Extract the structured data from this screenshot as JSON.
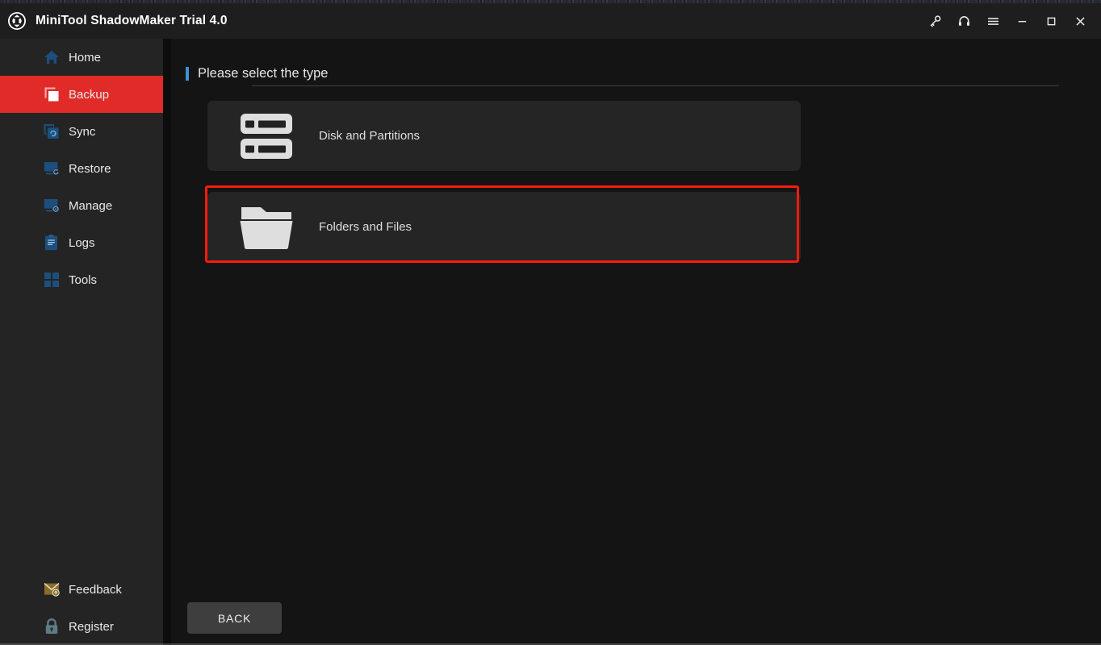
{
  "window": {
    "app_title": "MiniTool ShadowMaker Trial 4.0",
    "logo_icon": "refresh-circular-arrows-logo",
    "controls": [
      {
        "name": "key-icon",
        "label": "Key"
      },
      {
        "name": "headset-icon",
        "label": "Support"
      },
      {
        "name": "menu-icon",
        "label": "Menu"
      },
      {
        "name": "minimize-icon",
        "label": "Minimize"
      },
      {
        "name": "maximize-icon",
        "label": "Maximize"
      },
      {
        "name": "close-icon",
        "label": "Close"
      }
    ]
  },
  "sidebar": {
    "items": [
      {
        "label": "Home",
        "icon": "home-icon",
        "active": false
      },
      {
        "label": "Backup",
        "icon": "backup-icon",
        "active": true
      },
      {
        "label": "Sync",
        "icon": "sync-icon",
        "active": false
      },
      {
        "label": "Restore",
        "icon": "restore-icon",
        "active": false
      },
      {
        "label": "Manage",
        "icon": "manage-icon",
        "active": false
      },
      {
        "label": "Logs",
        "icon": "logs-icon",
        "active": false
      },
      {
        "label": "Tools",
        "icon": "tools-icon",
        "active": false
      }
    ],
    "bottom_items": [
      {
        "label": "Feedback",
        "icon": "feedback-envelope-icon"
      },
      {
        "label": "Register",
        "icon": "register-lock-icon"
      }
    ]
  },
  "main": {
    "page_title": "Please select the type",
    "options": [
      {
        "label": "Disk and Partitions",
        "icon": "disk-partitions-icon",
        "highlighted": false
      },
      {
        "label": "Folders and Files",
        "icon": "folder-files-icon",
        "highlighted": true
      }
    ],
    "back_label": "BACK"
  },
  "colors": {
    "accent_red": "#e02b28",
    "accent_blue": "#3f8fd6",
    "annotation_red": "#fb1a0f",
    "sidebar_bg": "#242424",
    "main_bg": "#141414",
    "card_bg": "#252525",
    "titlebar_bg": "#1e1e1e",
    "icon_blue": "#1d4f7c"
  }
}
